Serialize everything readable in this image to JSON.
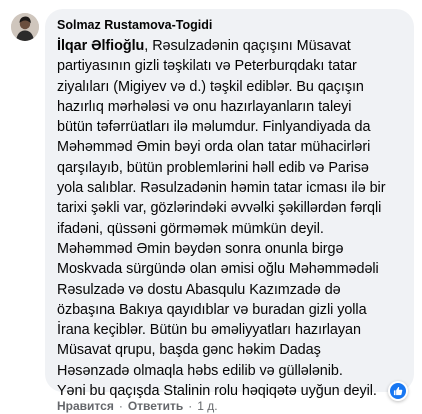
{
  "comment": {
    "author": "Solmaz Rustamova-Togidi",
    "mention": "İlqar Əlfioğlu",
    "first_line_rest": ", Rəsulzadənin qaçışını Müsavat",
    "lines": [
      "partiyasının gizli təşkilatı və Peterburqdakı tatar",
      "ziyalıları (Migiyev və d.) təşkil ediblər. Bu qaçışın",
      "hazırlıq mərhələsi və onu hazırlayanların taleyi",
      "bütün təfərrüatları ilə məlumdur. Finlyandiyada da",
      "Məhəmməd Əmin bəyi orda olan tatar mühacirləri",
      "qarşılayıb, bütün problemlərini həll edib və Parisə",
      "yola salıblar. Rəsulzadənin həmin tatar icması ilə bir",
      "tarixi şəkli var, gözlərindəki əvvəlki şəkillərdən fərqli",
      "ifadəni, qüssəni görməmək mümkün deyil.",
      "Məhəmməd Əmin bəydən sonra onunla birgə",
      "Moskvada sürgündə olan əmisi oğlu Məhəmmədəli",
      "Rəsulzadə və dostu Abasqulu Kazımzadə də",
      "özbaşına Bakıya qayıdıblar və buradan gizli yolla",
      "İrana keçiblər. Bütün bu əməliyyatları hazırlayan",
      "Müsavat qrupu, başda gənc həkim Dadaş",
      "Həsənzadə olmaqla həbs edilib və güllələnib.",
      "Yəni bu qaçışda Stalinin rolu həqiqətə uyğun deyil."
    ]
  },
  "actions": {
    "like": "Нравится",
    "reply": "Ответить",
    "time": "1 д."
  },
  "reaction": {
    "icon": "thumbs-up-icon",
    "color": "#1877f2"
  },
  "colors": {
    "bubble": "#f0f2f5",
    "text": "#050505",
    "secondary": "#65676b"
  }
}
